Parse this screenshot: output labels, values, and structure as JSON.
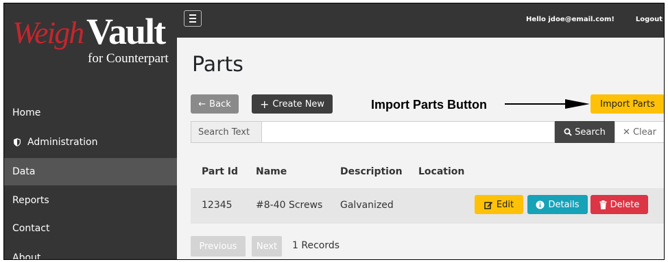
{
  "brand": {
    "name_part1": "Weigh",
    "name_part2": "Vault",
    "subtitle": "for Counterpart"
  },
  "sidebar": {
    "items": [
      {
        "label": "Home",
        "icon": null
      },
      {
        "label": "Administration",
        "icon": "shield-icon"
      },
      {
        "label": "Data",
        "icon": null,
        "active": true
      },
      {
        "label": "Reports",
        "icon": null
      },
      {
        "label": "Contact",
        "icon": null
      },
      {
        "label": "About",
        "icon": null
      }
    ]
  },
  "topbar": {
    "greeting": "Hello jdoe@email.com!",
    "logout": "Logout",
    "menu_icon": "hamburger-icon"
  },
  "page": {
    "title": "Parts"
  },
  "toolbar": {
    "back_label": "Back",
    "create_label": "Create New",
    "import_label": "Import Parts"
  },
  "annotation": {
    "label": "Import Parts Button"
  },
  "search": {
    "prefix": "Search Text",
    "value": "",
    "search_label": "Search",
    "clear_label": "Clear"
  },
  "table": {
    "headers": [
      "Part Id",
      "Name",
      "Description",
      "Location"
    ],
    "rows": [
      {
        "part_id": "12345",
        "name": "#8-40 Screws",
        "description": "Galvanized",
        "location": ""
      }
    ],
    "actions": {
      "edit": "Edit",
      "details": "Details",
      "delete": "Delete"
    }
  },
  "pagination": {
    "prev": "Previous",
    "next": "Next",
    "records": "1 Records"
  },
  "colors": {
    "sidebar_bg": "#353535",
    "active_bg": "#555555",
    "warning": "#ffc107",
    "info": "#17a2b8",
    "danger": "#dc3545",
    "brand_red": "#c4262e"
  }
}
